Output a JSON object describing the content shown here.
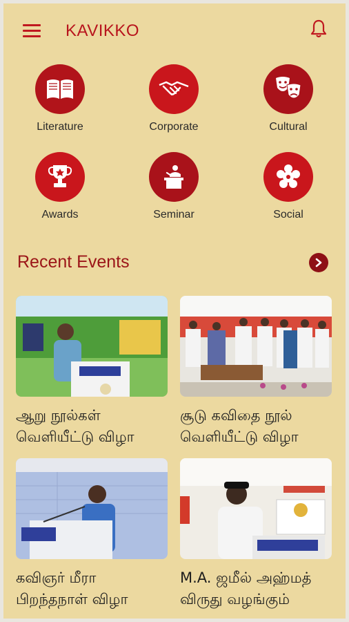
{
  "app": {
    "title": "KAVIKKO"
  },
  "categories": [
    {
      "label": "Literature",
      "icon": "book-icon",
      "color": "#b1141a"
    },
    {
      "label": "Corporate",
      "icon": "handshake-icon",
      "color": "#c9161c"
    },
    {
      "label": "Cultural",
      "icon": "theater-masks-icon",
      "color": "#a9121a"
    },
    {
      "label": "Awards",
      "icon": "trophy-icon",
      "color": "#c9161c"
    },
    {
      "label": "Seminar",
      "icon": "podium-speaker-icon",
      "color": "#a9121a"
    },
    {
      "label": "Social",
      "icon": "social-flower-icon",
      "color": "#c9161c"
    }
  ],
  "recent": {
    "title": "Recent Events",
    "events": [
      {
        "line1": "ஆறு  நூல்கள்",
        "line2": "வெளியீட்டு விழா"
      },
      {
        "line1": "சூடு கவிதை நூல்",
        "line2": "வெளியீட்டு விழா"
      },
      {
        "line1": "கவிஞர் மீரா",
        "line2": "பிறந்தநாள் விழா"
      },
      {
        "line1": "M.A. ஜமீல் அஹ்மத்",
        "line2": "விருது வழங்கும்"
      }
    ]
  },
  "colors": {
    "accent": "#b8151d",
    "background": "#ecd9a0"
  }
}
